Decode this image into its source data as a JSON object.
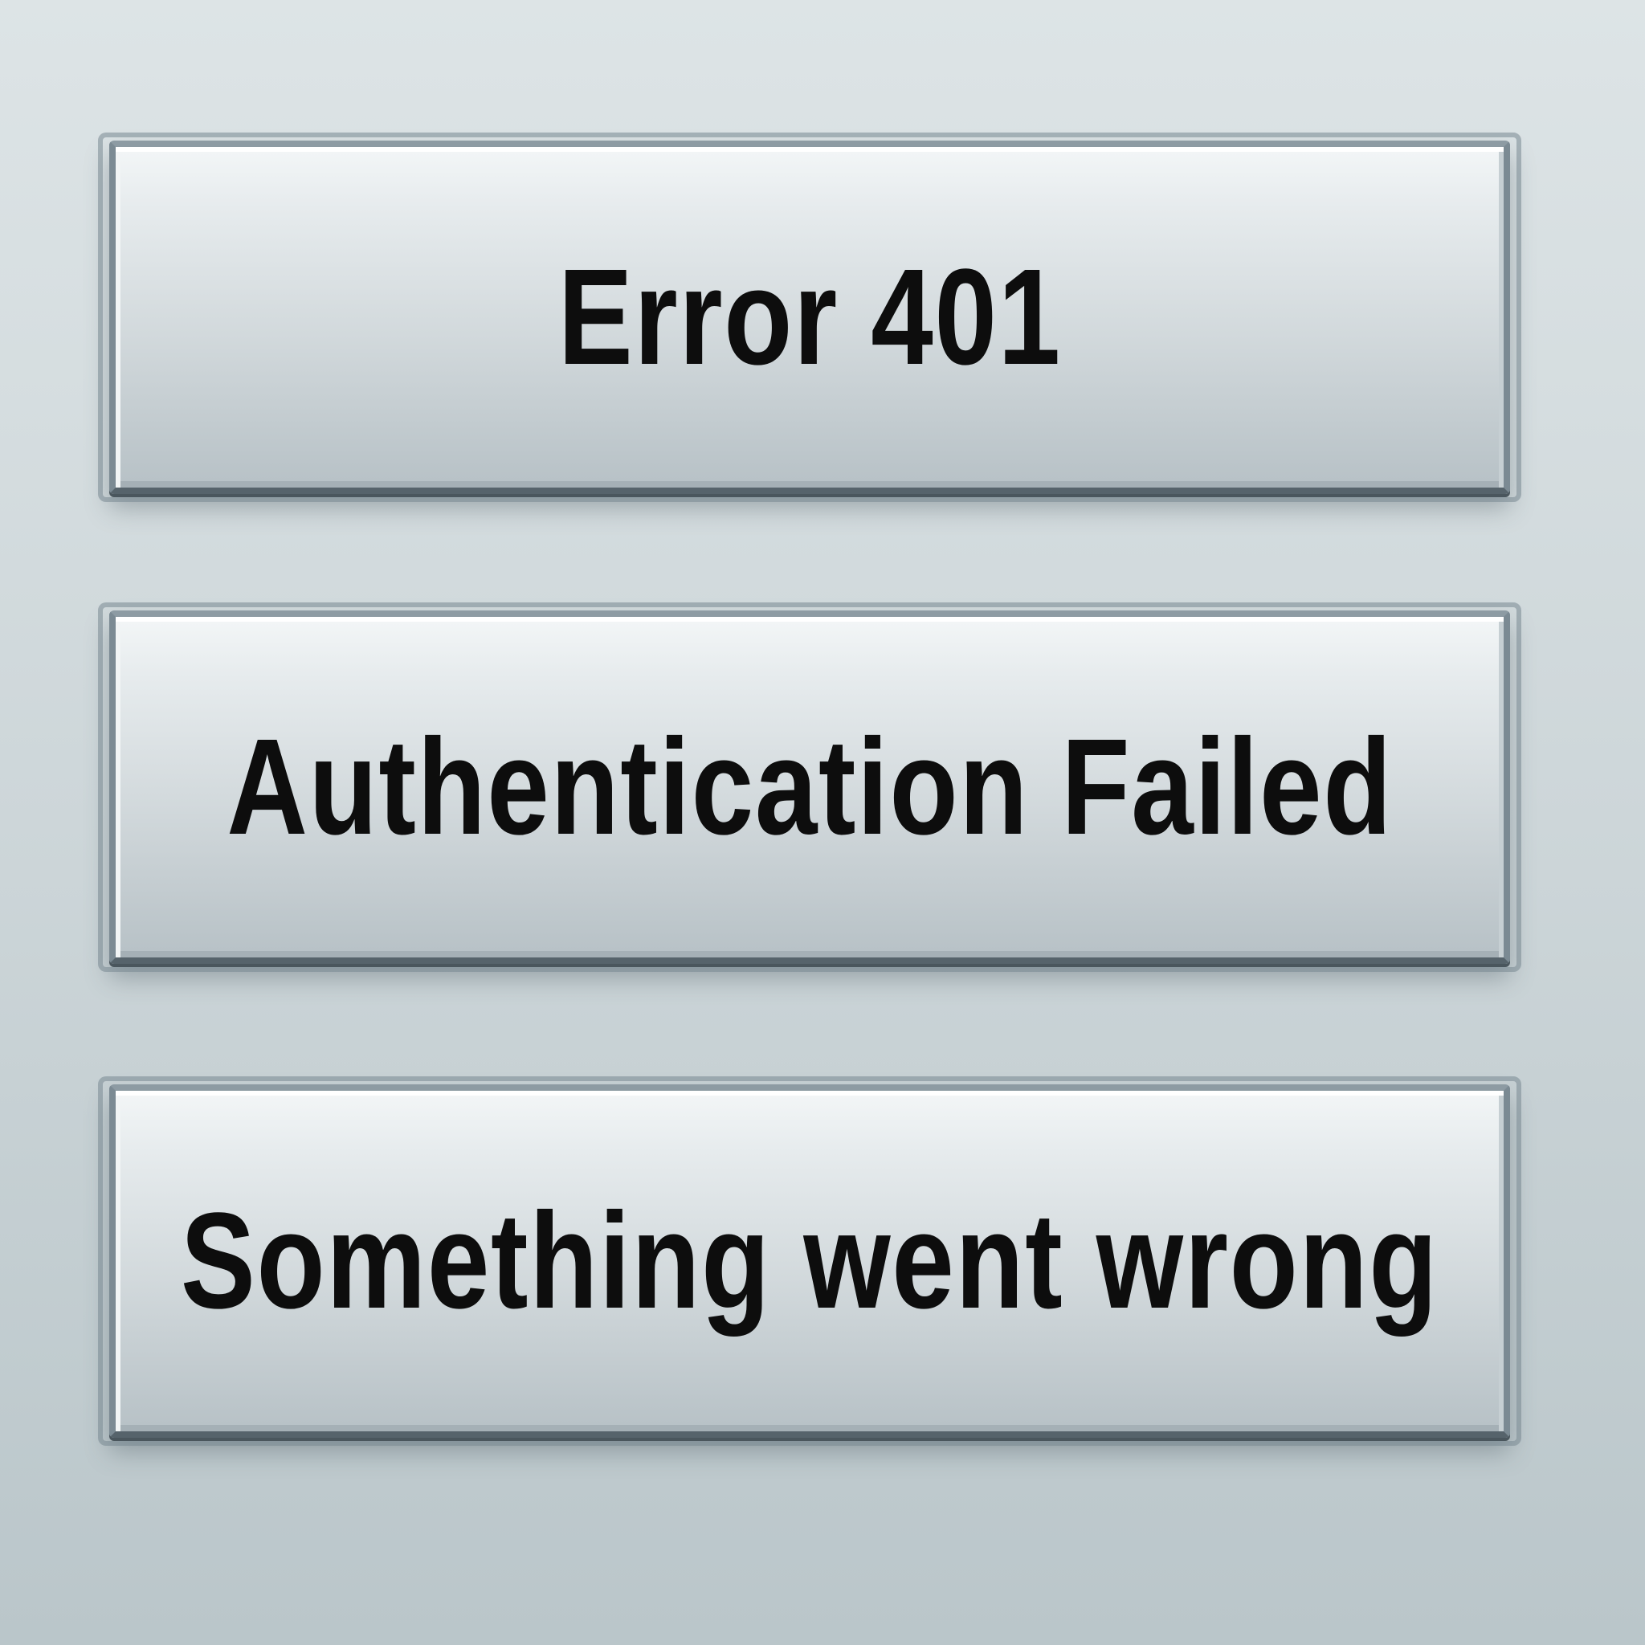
{
  "messages": [
    {
      "text": "Error 401"
    },
    {
      "text": "Authentication Failed"
    },
    {
      "text": "Something went wrong"
    }
  ],
  "colors": {
    "background": "#cdd6d9",
    "panel_face": "#dfe5e7",
    "panel_border": "#7b8a93",
    "text": "#0d0d0d"
  }
}
